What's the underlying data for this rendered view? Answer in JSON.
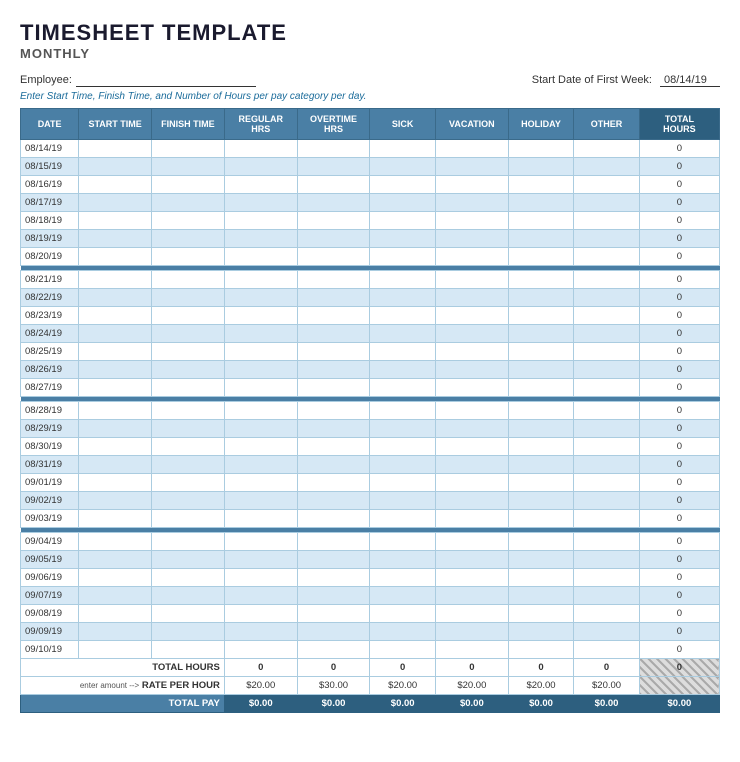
{
  "title": "TIMESHEET TEMPLATE",
  "subtitle": "MONTHLY",
  "employee_label": "Employee:",
  "start_date_label": "Start Date of First Week:",
  "start_date_value": "08/14/19",
  "instruction": "Enter Start Time, Finish Time, and Number of Hours per pay category per day.",
  "columns": {
    "date": "DATE",
    "start_time": "START TIME",
    "finish_time": "FINISH TIME",
    "regular_hrs": "REGULAR HRS",
    "overtime_hrs": "OVERTIME HRS",
    "sick": "SICK",
    "vacation": "VACATION",
    "holiday": "HOLIDAY",
    "other": "OTHER",
    "total_hours": "TOTAL HOURS"
  },
  "weeks": [
    {
      "rows": [
        {
          "date": "08/14/19",
          "style": "white"
        },
        {
          "date": "08/15/19",
          "style": "blue"
        },
        {
          "date": "08/16/19",
          "style": "white"
        },
        {
          "date": "08/17/19",
          "style": "blue"
        },
        {
          "date": "08/18/19",
          "style": "white"
        },
        {
          "date": "08/19/19",
          "style": "blue"
        },
        {
          "date": "08/20/19",
          "style": "white"
        }
      ]
    },
    {
      "rows": [
        {
          "date": "08/21/19",
          "style": "white"
        },
        {
          "date": "08/22/19",
          "style": "blue"
        },
        {
          "date": "08/23/19",
          "style": "white"
        },
        {
          "date": "08/24/19",
          "style": "blue"
        },
        {
          "date": "08/25/19",
          "style": "white"
        },
        {
          "date": "08/26/19",
          "style": "blue"
        },
        {
          "date": "08/27/19",
          "style": "white"
        }
      ]
    },
    {
      "rows": [
        {
          "date": "08/28/19",
          "style": "white"
        },
        {
          "date": "08/29/19",
          "style": "blue"
        },
        {
          "date": "08/30/19",
          "style": "white"
        },
        {
          "date": "08/31/19",
          "style": "blue"
        },
        {
          "date": "09/01/19",
          "style": "white"
        },
        {
          "date": "09/02/19",
          "style": "blue"
        },
        {
          "date": "09/03/19",
          "style": "white"
        }
      ]
    },
    {
      "rows": [
        {
          "date": "09/04/19",
          "style": "white"
        },
        {
          "date": "09/05/19",
          "style": "blue"
        },
        {
          "date": "09/06/19",
          "style": "white"
        },
        {
          "date": "09/07/19",
          "style": "blue"
        },
        {
          "date": "09/08/19",
          "style": "white"
        },
        {
          "date": "09/09/19",
          "style": "blue"
        },
        {
          "date": "09/10/19",
          "style": "white"
        }
      ]
    }
  ],
  "totals_row": {
    "label": "TOTAL HOURS",
    "values": [
      "0",
      "0",
      "0",
      "0",
      "0",
      "0",
      "0"
    ]
  },
  "rate_row": {
    "enter_label": "enter amount -->",
    "label": "RATE PER HOUR",
    "values": [
      "$20.00",
      "$30.00",
      "$20.00",
      "$20.00",
      "$20.00",
      "$20.00"
    ]
  },
  "total_pay_row": {
    "label": "TOTAL PAY",
    "values": [
      "$0.00",
      "$0.00",
      "$0.00",
      "$0.00",
      "$0.00",
      "$0.00",
      "$0.00"
    ]
  }
}
